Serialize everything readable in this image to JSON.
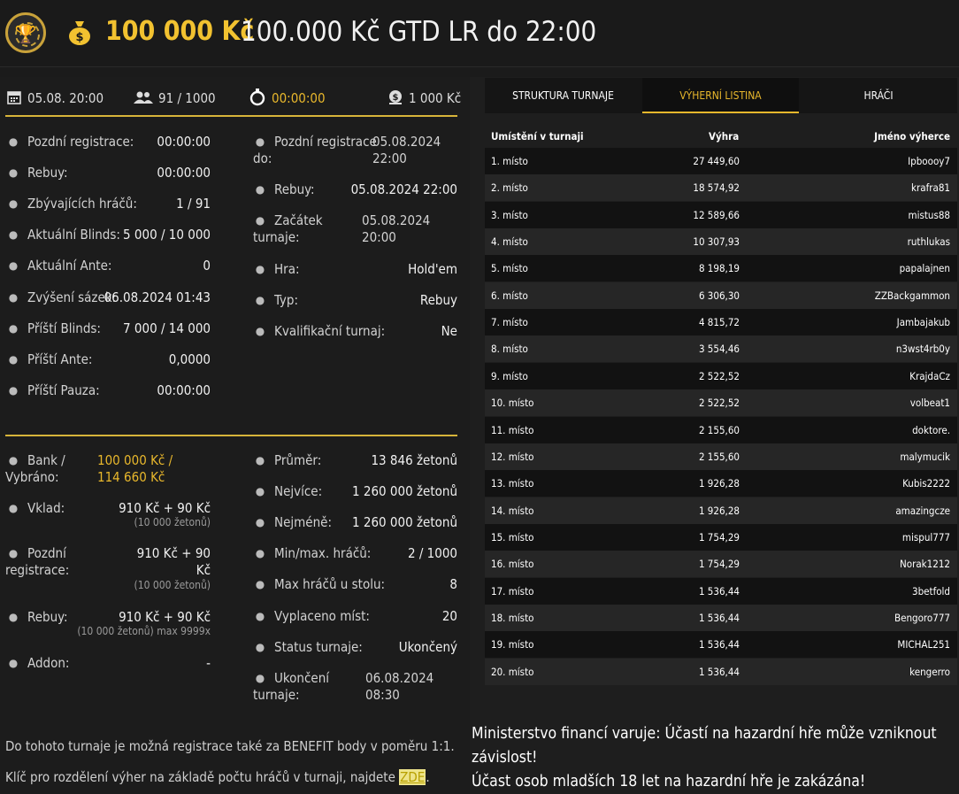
{
  "header": {
    "amount": "100 000 Kč",
    "title": "100.000 Kč GTD LR do 22:00"
  },
  "top_bar": {
    "date": "05.08. 20:00",
    "players": "91 / 1000",
    "timer": "00:00:00",
    "buyin": "1 000 Kč"
  },
  "info_left": [
    {
      "label": "Pozdní registrace:",
      "value": "00:00:00",
      "icon": "user-add-icon"
    },
    {
      "label": "Rebuy:",
      "value": "00:00:00",
      "icon": "chips-icon"
    },
    {
      "label": "Zbývajících hráčů:",
      "value": "1 / 91",
      "icon": "users-icon"
    },
    {
      "label": "Aktuální Blinds:",
      "value": "5 000 / 10 000",
      "icon": "chips-icon"
    },
    {
      "label": "Aktuální Ante:",
      "value": "0",
      "icon": "coin-icon"
    },
    {
      "label": "Zvýšení sázek:",
      "value": "06.08.2024 01:43",
      "icon": "arrow-up-icon"
    },
    {
      "label": "Příští Blinds:",
      "value": "7 000 / 14 000",
      "icon": "chips-icon"
    },
    {
      "label": "Příští Ante:",
      "value": "0,0000",
      "icon": "coin-icon"
    },
    {
      "label": "Příští Pauza:",
      "value": "00:00:00",
      "icon": "clock-icon"
    }
  ],
  "info_right": [
    {
      "label1": "Pozdní registrace",
      "label2": "do:",
      "value1": "05.08.2024",
      "value2": "22:00",
      "icon": "user-add-icon"
    },
    {
      "label1": "Rebuy:",
      "value1": "05.08.2024 22:00",
      "icon": "chips-icon"
    },
    {
      "label1": "Začátek",
      "label2": "turnaje:",
      "value1": "05.08.2024",
      "value2": "20:00",
      "icon": "flag-icon"
    },
    {
      "label1": "Hra:",
      "value1": "Hold'em",
      "icon": "cards-icon"
    },
    {
      "label1": "Typ:",
      "value1": "Rebuy",
      "icon": "clubs-icon"
    },
    {
      "label1": "Kvalifikační turnaj:",
      "value1": "Ne",
      "icon": "medal-icon"
    }
  ],
  "bottom_left": {
    "bank_label1": "Bank /",
    "bank_label2": "Vybráno:",
    "bank_value1": "100 000 Kč /",
    "bank_value2": "114 660 Kč",
    "vklad_label": "Vklad:",
    "vklad_value": "910 Kč + 90 Kč",
    "vklad_sub": "(10 000 žetonů)",
    "pozdni_label1": "Pozdní",
    "pozdni_label2": "registrace:",
    "pozdni_value1": "910 Kč + 90",
    "pozdni_value2": "Kč",
    "pozdni_sub": "(10 000 žetonů)",
    "rebuy_label": "Rebuy:",
    "rebuy_value": "910 Kč + 90 Kč",
    "rebuy_sub": "(10 000 žetonů) max 9999x",
    "addon_label": "Addon:",
    "addon_value": "-"
  },
  "bottom_right": [
    {
      "label1": "Průměr:",
      "value1": "13 846 žetonů",
      "icon": "chip-icon"
    },
    {
      "label1": "Nejvíce:",
      "value1": "1 260 000 žetonů",
      "icon": "chip-icon"
    },
    {
      "label1": "Nejméně:",
      "value1": "1 260 000 žetonů",
      "icon": "chip-icon"
    },
    {
      "label1": "Min/max. hráčů:",
      "value1": "2 / 1000",
      "icon": "users-icon"
    },
    {
      "label1": "Max hráčů u stolu:",
      "value1": "8",
      "icon": "table-icon"
    },
    {
      "label1": "Vyplaceno míst:",
      "value1": "20",
      "icon": "payout-icon"
    },
    {
      "label1": "Status turnaje:",
      "value1": "Ukončený",
      "icon": "info-icon"
    },
    {
      "label1": "Ukončení",
      "label2": "turnaje:",
      "value1": "06.08.2024",
      "value2": "08:30",
      "icon": "flag-icon"
    }
  ],
  "notes": {
    "benefit": "Do tohoto turnaje je možná registrace také za BENEFIT body v poměru 1:1.",
    "key_text": "Klíč pro rozdělení výher na základě počtu hráčů v turnaji, najdete ",
    "key_link": "ZDE",
    "key_end": "."
  },
  "tabs": [
    "STRUKTURA TURNAJE",
    "VÝHERNÍ LISTINA",
    "HRÁČI"
  ],
  "table": {
    "headers": [
      "Umístění v turnaji",
      "Výhra",
      "Jméno výherce"
    ],
    "rows": [
      [
        "1. místo",
        "27 449,60",
        "Ipboooy7"
      ],
      [
        "2. místo",
        "18 574,92",
        "krafra81"
      ],
      [
        "3. místo",
        "12 589,66",
        "mistus88"
      ],
      [
        "4. místo",
        "10 307,93",
        "ruthlukas"
      ],
      [
        "5. místo",
        "8 198,19",
        "papalajnen"
      ],
      [
        "6. místo",
        "6 306,30",
        "ZZBackgammon"
      ],
      [
        "7. místo",
        "4 815,72",
        "Jambajakub"
      ],
      [
        "8. místo",
        "3 554,46",
        "n3wst4rb0y"
      ],
      [
        "9. místo",
        "2 522,52",
        "KrajdaCz"
      ],
      [
        "10. místo",
        "2 522,52",
        "volbeat1"
      ],
      [
        "11. místo",
        "2 155,60",
        "doktore."
      ],
      [
        "12. místo",
        "2 155,60",
        "malymucik"
      ],
      [
        "13. místo",
        "1 926,28",
        "Kubis2222"
      ],
      [
        "14. místo",
        "1 926,28",
        "amazingcze"
      ],
      [
        "15. místo",
        "1 754,29",
        "mispul777"
      ],
      [
        "16. místo",
        "1 754,29",
        "Norak1212"
      ],
      [
        "17. místo",
        "1 536,44",
        "3betfold"
      ],
      [
        "18. místo",
        "1 536,44",
        "Bengoro777"
      ],
      [
        "19. místo",
        "1 536,44",
        "MICHAL251"
      ],
      [
        "20. místo",
        "1 536,44",
        "kengerro"
      ]
    ]
  },
  "warning": {
    "line1": "Ministerstvo financí varuje: Účastí na hazardní hře může vzniknout závislost!",
    "line2": "Účast osob mladších 18 let na hazardní hře je zakázána!"
  }
}
